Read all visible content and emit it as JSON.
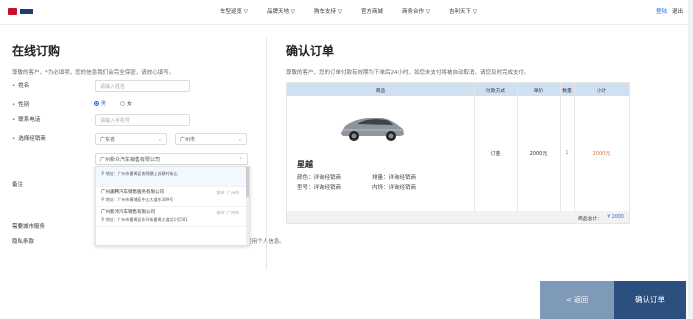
{
  "header": {
    "nav": [
      "车型巡览 ▽",
      "品牌天地 ▽",
      "购车支持 ▽",
      "官方商城",
      "商务合作 ▽",
      "吉利天下 ▽"
    ],
    "login": "登陆",
    "logout": "退出"
  },
  "left": {
    "title": "在线订购",
    "subtitle": "尊敬的客户，*为必填项，您的信息我们会完全保密，请放心填写。",
    "fields": {
      "name_label": "姓名",
      "name_placeholder": "请输入姓名",
      "gender_label": "性别",
      "gender_male": "男",
      "gender_female": "女",
      "phone_label": "联系电话",
      "phone_placeholder": "请输入手机号",
      "dealer_label": "选择经销商",
      "province": "广东省",
      "city": "广州市",
      "dealer_selected": "广州新众汽车销售有限公司",
      "remark_label": "备注",
      "city_label": "需要城市服务",
      "privacy_label": "隐私条款",
      "privacy_text": "阅读并同意《用户服务协议》和《隐私保护政策》，同意接收并使用个人信息。"
    },
    "dropdown": [
      {
        "name": "",
        "city": "",
        "addr": "地址：广州市番禺区南锦横上苏耕村街山"
      },
      {
        "name": "广州骏腾汽车销售服务有限公司",
        "city": "城市: 广州市",
        "addr": "地址：广州市黄埔区中山大道东389号"
      },
      {
        "name": "广州新鸿汽车销售有限公司",
        "city": "城市: 广州市",
        "addr": "地址：广州市番禺区东环街番禺大道北1号501"
      }
    ]
  },
  "right": {
    "title": "确认订单",
    "subtitle": "尊敬的客户，您的订单付款有效期为下单后24小时，如您未支付将被自动取消，请您及时完成支付。",
    "table": {
      "headers": [
        "商品",
        "付款方式",
        "单价",
        "数量",
        "小计"
      ],
      "product_name": "星越",
      "color_label": "颜色：",
      "color_value": "详询经销商",
      "model_label": "型号：",
      "model_value": "详询经销商",
      "displacement_label": "排量：",
      "displacement_value": "详询经销商",
      "interior_label": "内饰：",
      "interior_value": "详询经销商",
      "payment": "订金",
      "unit_price": "2000元",
      "quantity": "1",
      "subtotal": "2000元",
      "total_label": "商品总计：",
      "total_value": "¥ 2000"
    }
  },
  "buttons": {
    "back": "< 返回",
    "confirm": "确认订单"
  },
  "colors": {
    "accent": "#2b4f7e",
    "back_button": "#7f99b8",
    "table_header": "#cfe0f0",
    "subtotal": "#e0703a",
    "required": "#e33333"
  }
}
